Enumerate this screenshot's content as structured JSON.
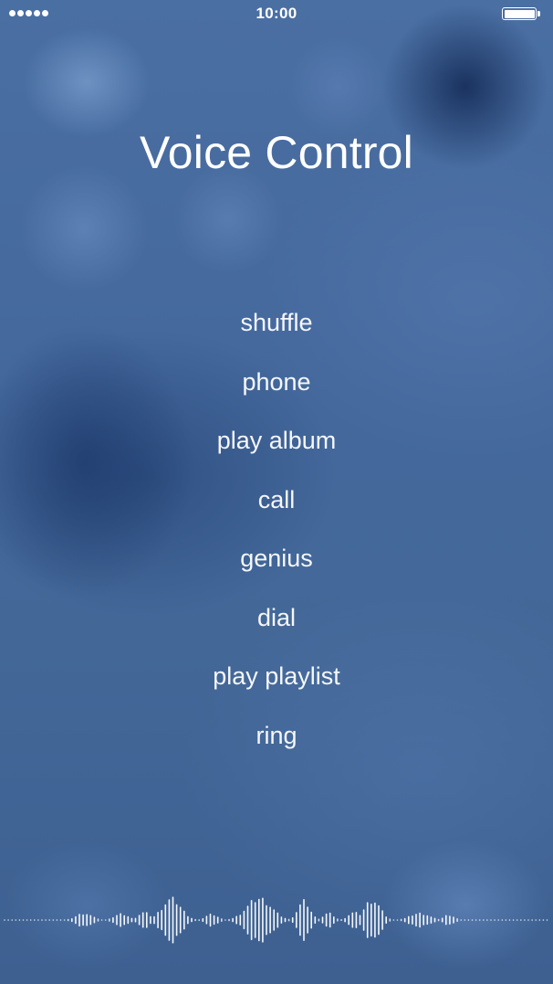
{
  "status_bar": {
    "signal_dots": 5,
    "time": "10:00",
    "battery_level": 1.0
  },
  "title": "Voice Control",
  "commands": [
    "shuffle",
    "phone",
    "play album",
    "call",
    "genius",
    "dial",
    "play playlist",
    "ring"
  ],
  "waveform": {
    "state": "listening",
    "icon": "audio-waveform-icon",
    "color": "#ffffff"
  },
  "colors": {
    "background": "#44689a",
    "text": "#ffffff"
  }
}
